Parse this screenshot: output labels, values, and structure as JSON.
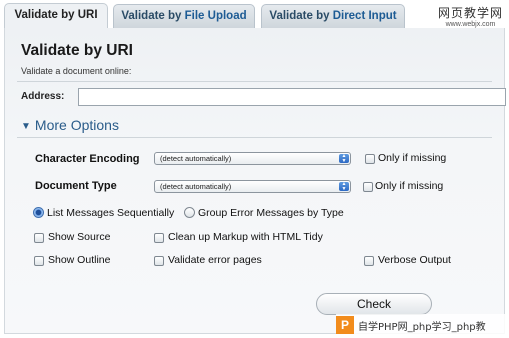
{
  "tabs": [
    {
      "label_prefix": "Validate by ",
      "label_highlight": "URI"
    },
    {
      "label_prefix": "Validate by ",
      "label_highlight": "File Upload"
    },
    {
      "label_prefix": "Validate by ",
      "label_highlight": "Direct Input"
    }
  ],
  "watermark_top": {
    "title": "网页教学网",
    "url": "www.webjx.com"
  },
  "page": {
    "title": "Validate by URI",
    "subtitle": "Validate a document online:"
  },
  "address": {
    "label": "Address:",
    "value": ""
  },
  "more_options": {
    "label": "More Options",
    "icon": "disclosure-triangle-icon"
  },
  "character_encoding": {
    "label": "Character Encoding",
    "selected": "(detect automatically)",
    "only_if_missing_label": "Only if missing",
    "only_if_missing_checked": false
  },
  "document_type": {
    "label": "Document Type",
    "selected": "(detect automatically)",
    "only_if_missing_label": "Only if missing",
    "only_if_missing_checked": false
  },
  "grouping": {
    "list_sequentially_label": "List Messages Sequentially",
    "list_sequentially_selected": true,
    "group_by_type_label": "Group Error Messages by Type",
    "group_by_type_selected": false
  },
  "options": {
    "show_source": "Show Source",
    "clean_up_markup": "Clean up Markup with HTML Tidy",
    "show_outline": "Show Outline",
    "validate_error_pages": "Validate error pages",
    "verbose_output": "Verbose Output"
  },
  "check_button": {
    "label": "Check"
  },
  "watermark_bottom": {
    "logo": "P",
    "text": "自学PHP网_php学习_php教"
  }
}
